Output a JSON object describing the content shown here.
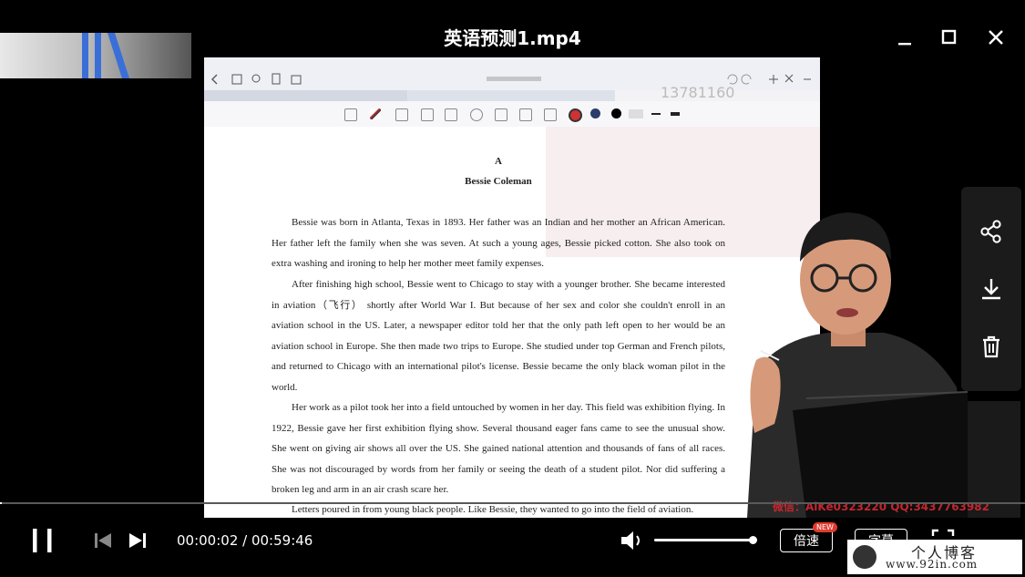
{
  "window": {
    "title": "英语预测1.mp4"
  },
  "icons": {
    "minimize": "minimize-icon",
    "maximize": "maximize-icon",
    "close": "close-icon",
    "share": "share-icon",
    "download": "download-icon",
    "delete": "trash-icon",
    "play_pause": "pause-icon",
    "prev": "skip-previous-icon",
    "next": "skip-next-icon",
    "volume": "volume-icon",
    "fullscreen": "fullscreen-icon"
  },
  "document": {
    "letter": "A",
    "heading": "Bessie Coleman",
    "paragraphs": [
      "Bessie was born in Atlanta, Texas in 1893. Her father was an Indian and her mother an African American. Her father left the family when she was seven. At such a young ages, Bessie picked cotton. She also took on extra washing and ironing to help her mother meet family expenses.",
      "After finishing high school, Bessie went to Chicago to stay with a younger brother. She became interested in aviation（飞行） shortly after World War I. But because of her sex and color she couldn't enroll in an aviation school in the US. Later, a newspaper editor told her that the only path left open to her would be an aviation school in Europe. She then made two trips to Europe. She studied under top German and French pilots, and returned to Chicago with an international pilot's license. Bessie became the only black woman pilot in the world.",
      "Her work as a pilot took her into a field untouched by women in her day. This field was exhibition flying. In 1922, Bessie gave her first exhibition flying show. Several thousand eager fans came to see the unusual show. She went on giving air shows all over the US. She gained national attention and thousands of fans of all races. She was not discouraged by words from her family or seeing the death of a student pilot. Nor did suffering a broken leg and arm in an air crash scare her.",
      "Letters poured in from young black people. Like Bessie, they wanted to go into the field of aviation."
    ],
    "overlay_number": "13781160"
  },
  "player": {
    "progress_fraction": 0.0006,
    "time_current": "00:00:02",
    "time_separator": " / ",
    "time_total": "00:59:46",
    "volume_fraction": 1.0,
    "speed_label": "倍速",
    "new_badge": "NEW",
    "subtitle_label": "字幕"
  },
  "watermarks": {
    "contact": "微信：AiKe0323220    QQ:3437763982",
    "blog_name": "个人博客",
    "blog_url": "www.92in.com"
  },
  "colors": {
    "background": "#000000",
    "accent_red": "#e03a2f",
    "document_bg": "#ffffff"
  }
}
